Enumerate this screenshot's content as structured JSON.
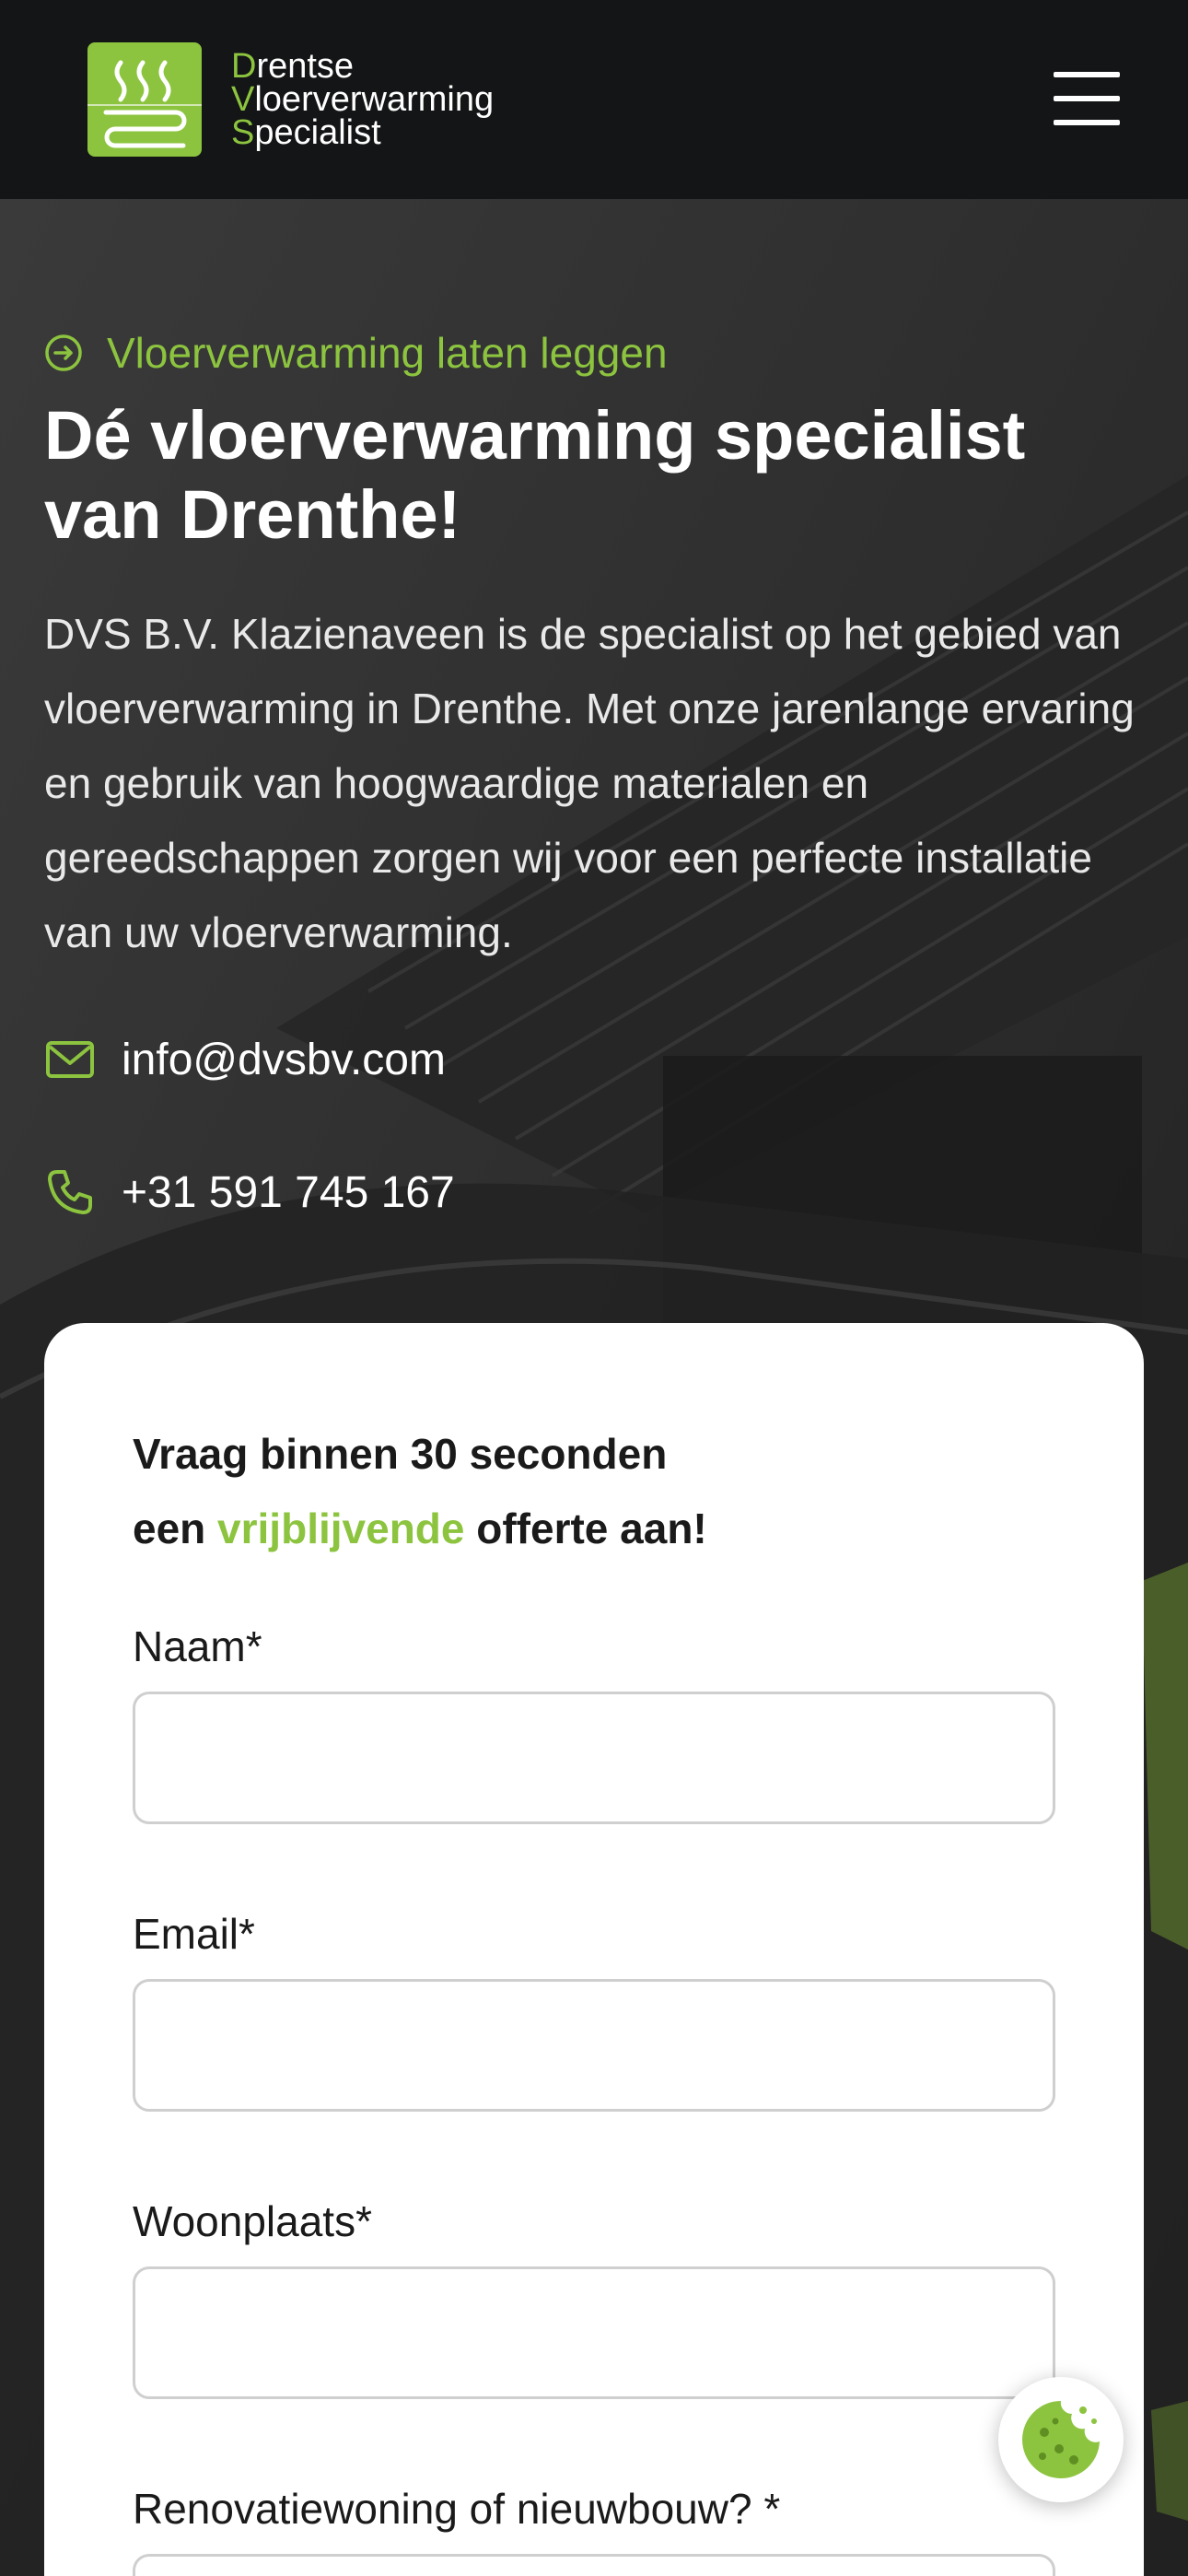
{
  "colors": {
    "accent": "#8cc43f",
    "header_bg": "#141516",
    "hero_overlay": "#2b2b2b",
    "text_light": "#ffffff",
    "text_dark": "#1a1a1a"
  },
  "header": {
    "logo": {
      "icon": "floor-heating-logo-icon",
      "lines": [
        {
          "initial": "D",
          "rest": "rentse"
        },
        {
          "initial": "V",
          "rest": "loerverwarming"
        },
        {
          "initial": "S",
          "rest": "pecialist"
        }
      ]
    },
    "menu_icon": "hamburger-menu-icon"
  },
  "hero": {
    "eyebrow": "Vloerverwarming laten leggen",
    "eyebrow_icon": "arrow-circle-right-icon",
    "title": "Dé vloerverwarming specialist van Drenthe!",
    "lead": "DVS B.V. Klazienaveen is de specialist op het gebied van vloerverwarming in Drenthe. Met onze jarenlange ervaring en gebruik van hoogwaardige materialen en gereedschappen zorgen wij voor een perfecte installatie van uw vloerverwarming.",
    "email": {
      "icon": "mail-icon",
      "value": "info@dvsbv.com"
    },
    "phone": {
      "icon": "phone-icon",
      "value": "+31 591 745 167"
    }
  },
  "form": {
    "title_line1": "Vraag binnen 30 seconden",
    "title_line2_before": "een ",
    "title_line2_accent": "vrijblijvende",
    "title_line2_after": " offerte aan!",
    "fields": [
      {
        "label": "Naam*",
        "value": "",
        "placeholder": ""
      },
      {
        "label": "Email*",
        "value": "",
        "placeholder": ""
      },
      {
        "label": "Woonplaats*",
        "value": "",
        "placeholder": ""
      },
      {
        "label": "Renovatiewoning of nieuwbouw? *",
        "value": "",
        "placeholder": ""
      }
    ]
  },
  "cookie_button": {
    "icon": "cookie-icon"
  }
}
